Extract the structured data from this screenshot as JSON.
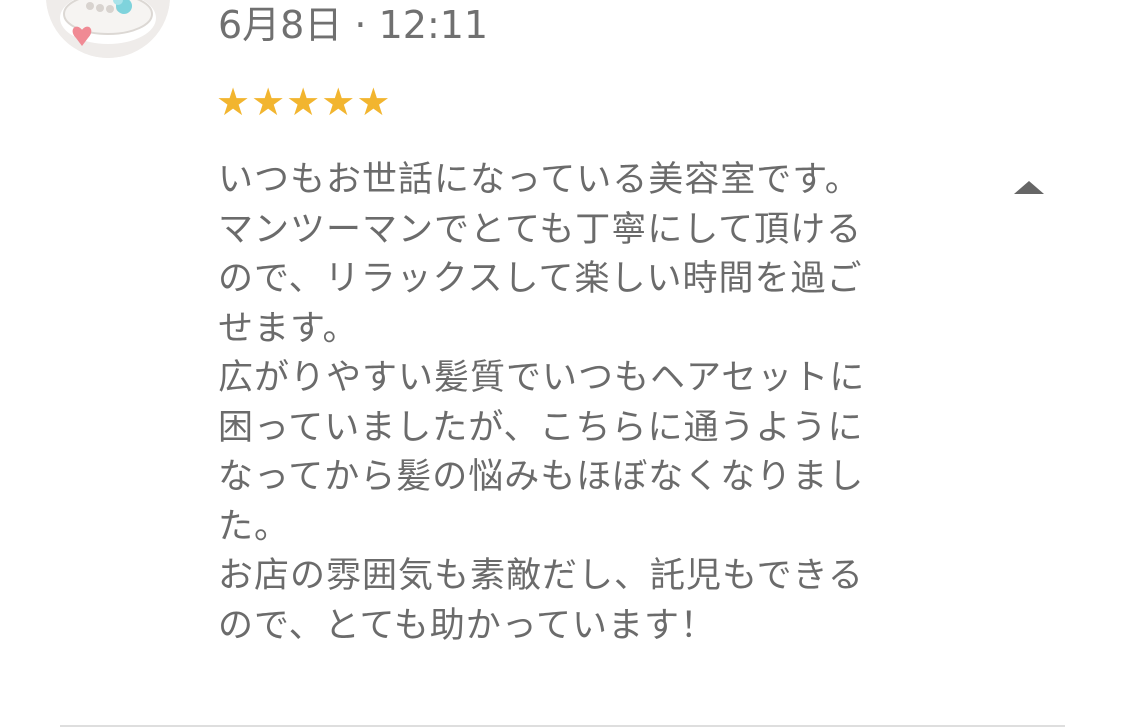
{
  "review": {
    "date": "6月8日 · 12:11",
    "rating": 5,
    "stars": [
      "★",
      "★",
      "★",
      "★",
      "★"
    ],
    "lines": [
      "いつもお世話になっている美容室です。",
      "マンツーマンでとても丁寧にして頂ける",
      "ので、リラックスして楽しい時間を過ご",
      "せます。",
      "広がりやすい髪質でいつもヘアセットに",
      "困っていましたが、こちらに通うように",
      "なってから髪の悩みもほぼなくなりまし",
      "た。",
      "お店の雰囲気も素敵だし、託児もできる",
      "ので、とても助かっています！"
    ]
  },
  "icons": {
    "collapse": "triangle-up-icon",
    "avatar": "user-avatar"
  },
  "colors": {
    "star": "#f2b52f",
    "text": "#6b6b6b",
    "date": "#707070",
    "collapse_icon": "#666666",
    "divider": "#dedede"
  }
}
